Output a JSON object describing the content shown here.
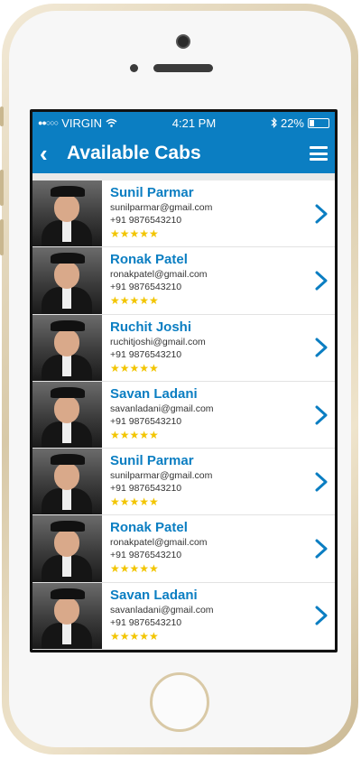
{
  "status_bar": {
    "signal": "●●○○○",
    "carrier": "VIRGIN",
    "wifi_icon": "wifi-icon",
    "time": "4:21 PM",
    "bluetooth_icon": "bluetooth-icon",
    "battery": "22%"
  },
  "nav": {
    "back_icon": "‹",
    "title": "Available Cabs",
    "menu_icon": "hamburger-icon"
  },
  "accent_color": "#0b7ec2",
  "star_color": "#f2c500",
  "drivers": [
    {
      "name": "Sunil Parmar",
      "email": "sunilparmar@gmail.com",
      "phone": "+91 9876543210",
      "stars": "★★★★★",
      "rating": 5
    },
    {
      "name": "Ronak Patel",
      "email": "ronakpatel@gmail.com",
      "phone": "+91 9876543210",
      "stars": "★★★★★",
      "rating": 5
    },
    {
      "name": "Ruchit Joshi",
      "email": "ruchitjoshi@gmail.com",
      "phone": "+91 9876543210",
      "stars": "★★★★★",
      "rating": 5
    },
    {
      "name": "Savan Ladani",
      "email": "savanladani@gmail.com",
      "phone": "+91 9876543210",
      "stars": "★★★★★",
      "rating": 5
    },
    {
      "name": "Sunil Parmar",
      "email": "sunilparmar@gmail.com",
      "phone": "+91 9876543210",
      "stars": "★★★★★",
      "rating": 5
    },
    {
      "name": "Ronak Patel",
      "email": "ronakpatel@gmail.com",
      "phone": "+91 9876543210",
      "stars": "★★★★★",
      "rating": 5
    },
    {
      "name": "Savan Ladani",
      "email": "savanladani@gmail.com",
      "phone": "+91 9876543210",
      "stars": "★★★★★",
      "rating": 5
    }
  ]
}
